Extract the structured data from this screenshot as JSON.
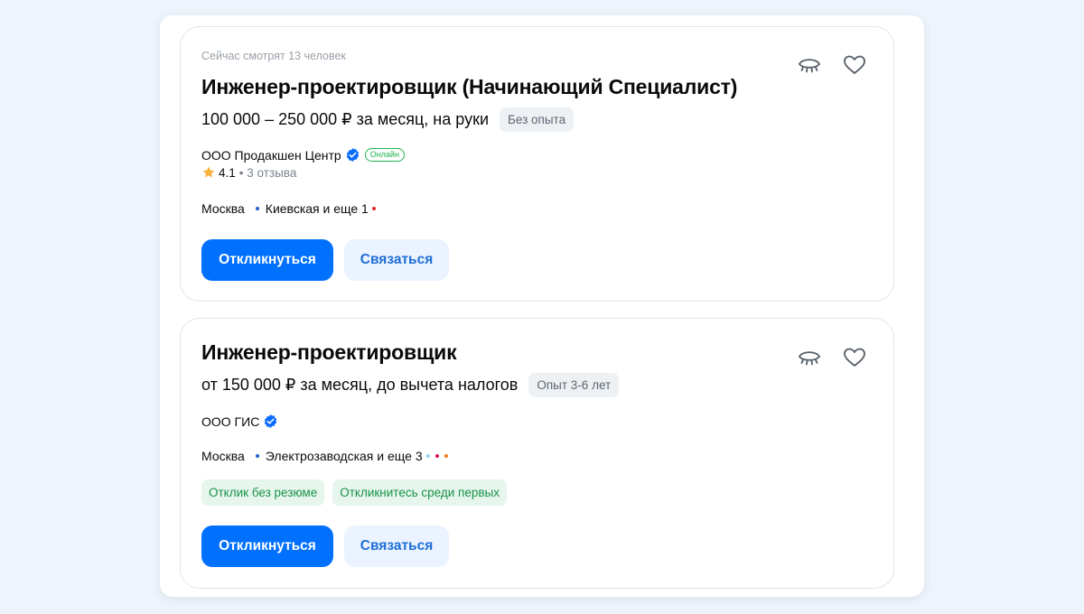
{
  "vacancies": [
    {
      "watchers": "Сейчас смотрят 13 человек",
      "title": "Инженер-проектировщик (Начинающий Специалист)",
      "salary": "100 000 – 250 000 ₽ за месяц, на руки",
      "experience": "Без опыта",
      "company": "ООО Продакшен Центр",
      "online_badge": "Онлайн",
      "rating": "4.1",
      "reviews": "• 3 отзыва",
      "city": "Москва",
      "metro": "Киевская и еще 1",
      "metro_colors": [
        "#1e63c8"
      ],
      "metro_tail_colors": [
        "#e0282e"
      ],
      "apply_label": "Откликнуться",
      "contact_label": "Связаться"
    },
    {
      "title": "Инженер-проектировщик",
      "salary": "от 150 000 ₽ за месяц, до вычета налогов",
      "experience": "Опыт 3-6 лет",
      "company": "ООО ГИС",
      "city": "Москва",
      "metro": "Электрозаводская и еще 3",
      "metro_colors": [
        "#1e63c8"
      ],
      "metro_tail_colors": [
        "#8fd6e8",
        "#d6145a",
        "#f07a1e"
      ],
      "tags": [
        "Отклик без резюме",
        "Откликнитесь среди первых"
      ],
      "apply_label": "Откликнуться",
      "contact_label": "Связаться"
    }
  ],
  "colors": {
    "accent": "#0070ff",
    "verified": "#0a6cff",
    "online": "#1fb34f",
    "star": "#f8b13d"
  },
  "icons": {
    "hide": "eye-closed-icon",
    "favorite": "heart-icon",
    "verified": "verified-check-icon",
    "star": "star-icon"
  }
}
